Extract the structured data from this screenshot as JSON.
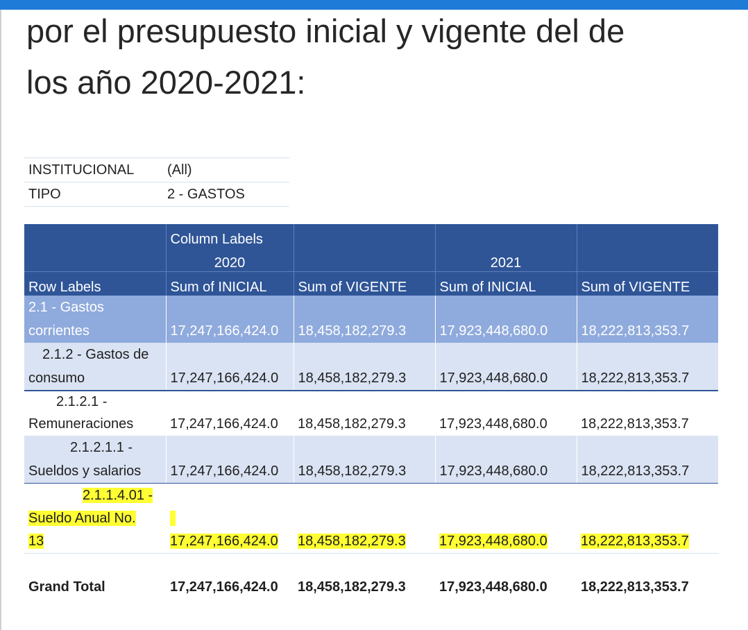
{
  "heading": {
    "line1": "por el presupuesto inicial y vigente del de",
    "line2": "los año 2020-2021:"
  },
  "filters": [
    {
      "key": "INSTITUCIONAL",
      "value": "(All)"
    },
    {
      "key": "TIPO",
      "value": "2 - GASTOS"
    }
  ],
  "pivot": {
    "column_labels": "Column Labels",
    "years": [
      "2020",
      "2021"
    ],
    "row_labels_header": "Row Labels",
    "measures": [
      "Sum of INICIAL",
      "Sum of  VIGENTE",
      "Sum of INICIAL",
      "Sum of  VIGENTE"
    ],
    "rows": [
      {
        "label": "2.1 - Gastos corrientes",
        "values": [
          "17,247,166,424.0",
          "18,458,182,279.3",
          "17,923,448,680.0",
          "18,222,813,353.7"
        ]
      },
      {
        "label_a": "2.1.2 - Gastos de",
        "label_b": "consumo",
        "values": [
          "17,247,166,424.0",
          "18,458,182,279.3",
          "17,923,448,680.0",
          "18,222,813,353.7"
        ]
      },
      {
        "label_a": "2.1.2.1 -",
        "label_b": "Remuneraciones",
        "values": [
          "17,247,166,424.0",
          "18,458,182,279.3",
          "17,923,448,680.0",
          "18,222,813,353.7"
        ]
      },
      {
        "label_a": "2.1.2.1.1 -",
        "label_b": "Sueldos y salarios",
        "values": [
          "17,247,166,424.0",
          "18,458,182,279.3",
          "17,923,448,680.0",
          "18,222,813,353.7"
        ]
      },
      {
        "label_a": "2.1.1.4.01 -",
        "label_b": "Sueldo Anual No.",
        "label_c": "13",
        "values": [
          "17,247,166,424.0",
          "18,458,182,279.3",
          "17,923,448,680.0",
          "18,222,813,353.7"
        ]
      }
    ],
    "grand_total": {
      "label": "Grand Total",
      "values": [
        "17,247,166,424.0",
        "18,458,182,279.3",
        "17,923,448,680.0",
        "18,222,813,353.7"
      ]
    }
  },
  "colors": {
    "header_dark": "#2f5597",
    "row_mid": "#8faadc",
    "row_light": "#dae3f3",
    "highlight": "#ffff33",
    "top_bar": "#1f7bd8"
  }
}
